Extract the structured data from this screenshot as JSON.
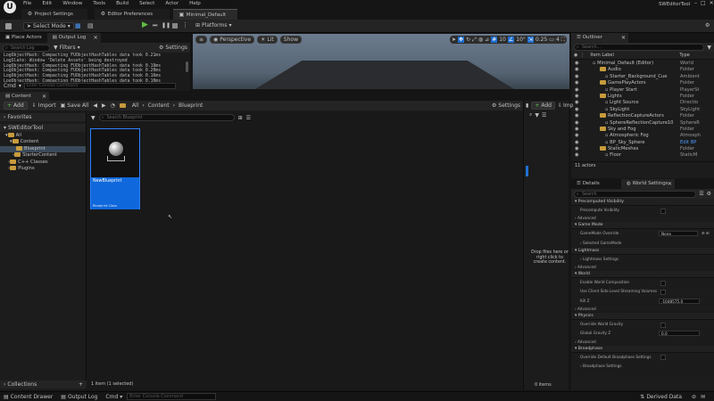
{
  "menu": {
    "items": [
      "File",
      "Edit",
      "Window",
      "Tools",
      "Build",
      "Select",
      "Actor",
      "Help"
    ],
    "project_name": "SWEditorTool"
  },
  "doc_tabs": [
    {
      "label": "Project Settings"
    },
    {
      "label": "Editor Preferences"
    },
    {
      "label": "Minimal_Default"
    }
  ],
  "toolbar": {
    "mode_label": "Select Mode",
    "platforms_label": "Platforms"
  },
  "place_actors": {
    "tab": "Place Actors",
    "output_tab": "Output Log",
    "search_placeholder": "Search Log",
    "filters_label": "Filters",
    "settings_label": "Settings"
  },
  "log_lines": [
    "LogObjectHash: Compacting FUObjectHashTables data took  0.21ms",
    "LogSlate: Window 'Delete Assets' being destroyed",
    "LogObjectHash: Compacting FUObjectHashTables data took  0.19ms",
    "LogObjectHash: Compacting FUObjectHashTables data took  0.20ms",
    "LogObjectHash: Compacting FUObjectHashTables data took  0.16ms",
    "LogObjectHash: Compacting FUObjectHashTables data took  0.10ms"
  ],
  "cmd": {
    "label": "Cmd",
    "placeholder": "Enter Console Command"
  },
  "viewport": {
    "perspective": "Perspective",
    "lit": "Lit",
    "show": "Show",
    "grid": "10",
    "angle": "10°",
    "scale": "0.25",
    "cam": "4"
  },
  "content_browser": {
    "tab": "Content Browse...",
    "add": "Add",
    "import": "Import",
    "save_all": "Save All",
    "path": [
      "All",
      "Content",
      "Blueprint"
    ],
    "settings": "Settings",
    "favorites": "Favorites",
    "project": "SWEditorTool",
    "tree": [
      "All",
      "Content",
      "Blueprint",
      "StarterContent",
      "C++ Classes",
      "Plugins"
    ],
    "search_placeholder": "Search Blueprint",
    "asset_name": "NewBlueprint",
    "asset_type": "Blueprint Class",
    "collections": "Collections",
    "status": "1 item (1 selected)"
  },
  "drop_panel": {
    "add": "Add",
    "imp": "Imp",
    "text": "Drop files here or right click to create content.",
    "status": "0 items"
  },
  "outliner": {
    "tab": "Outliner",
    "search_placeholder": "Search...",
    "col_label": "Item Label",
    "col_type": "Type",
    "rows": [
      {
        "label": "Minimal_Default (Editor)",
        "type": "World"
      },
      {
        "label": "Audio",
        "type": "Folder"
      },
      {
        "label": "Starter_Background_Cue",
        "type": "Ambient"
      },
      {
        "label": "GamePlayActors",
        "type": "Folder"
      },
      {
        "label": "Player Start",
        "type": "PlayerSt"
      },
      {
        "label": "Lights",
        "type": "Folder"
      },
      {
        "label": "Light Source",
        "type": "Directio"
      },
      {
        "label": "SkyLight",
        "type": "SkyLight"
      },
      {
        "label": "ReflectionCaptureActors",
        "type": "Folder"
      },
      {
        "label": "SphereReflectionCapture10",
        "type": "SphereR"
      },
      {
        "label": "Sky and Fog",
        "type": "Folder"
      },
      {
        "label": "Atmospheric Fog",
        "type": "Atmosph"
      },
      {
        "label": "BP_Sky_Sphere",
        "type": "Edit BP"
      },
      {
        "label": "StaticMeshes",
        "type": "Folder"
      },
      {
        "label": "Floor",
        "type": "StaticM"
      }
    ],
    "count": "11 actors"
  },
  "details": {
    "tab": "Details",
    "world_tab": "World Settings",
    "search_placeholder": "Search",
    "sections": [
      {
        "title": "Precomputed Visibility",
        "props": [
          "Precompute Visibility",
          "Advanced"
        ]
      },
      {
        "title": "Game Mode",
        "props": [
          "GameMode Override",
          "Selected GameMode"
        ]
      },
      {
        "title": "Lightmass",
        "props": [
          "Lightmass Settings",
          "Advanced"
        ]
      },
      {
        "title": "World",
        "props": [
          "Enable World Composition",
          "Use Client Side Level Streaming Volumes",
          "Kill Z",
          "Advanced"
        ]
      },
      {
        "title": "Physics",
        "props": [
          "Override World Gravity",
          "Global Gravity Z",
          "Advanced"
        ]
      },
      {
        "title": "Broadphase",
        "props": [
          "Override Default Broadphase Settings",
          "Broadphase Settings"
        ]
      }
    ],
    "gamemode_value": "None",
    "killz_value": "-1048575.0",
    "gravity_value": "0.0"
  },
  "statusbar": {
    "content_drawer": "Content Drawer",
    "output_log": "Output Log",
    "cmd": "Cmd",
    "console_placeholder": "Enter Console Command",
    "derived": "Derived Data"
  }
}
